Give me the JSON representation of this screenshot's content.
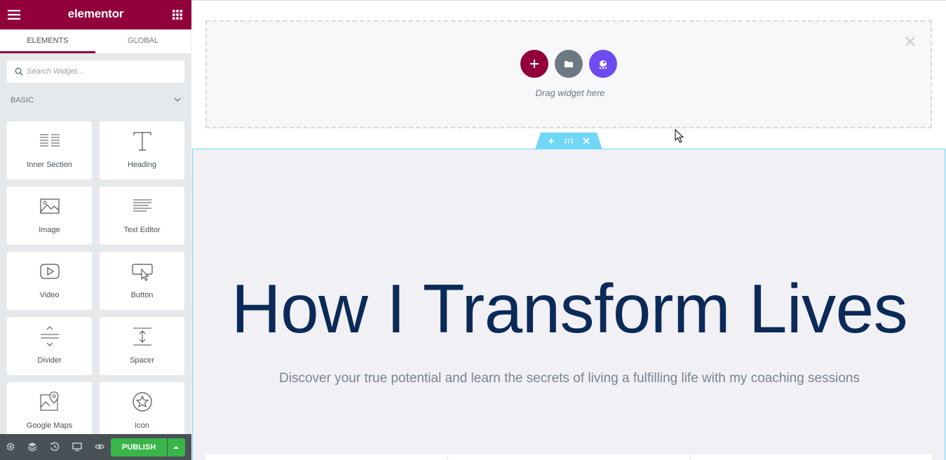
{
  "sidebar": {
    "logo": "elementor",
    "tabs": [
      {
        "label": "ELEMENTS",
        "active": true
      },
      {
        "label": "GLOBAL",
        "active": false
      }
    ],
    "search": {
      "placeholder": "Search Widget..."
    },
    "category": "BASIC",
    "widgets": [
      {
        "label": "Inner Section",
        "icon": "inner-section-icon"
      },
      {
        "label": "Heading",
        "icon": "heading-icon"
      },
      {
        "label": "Image",
        "icon": "image-icon"
      },
      {
        "label": "Text Editor",
        "icon": "text-editor-icon"
      },
      {
        "label": "Video",
        "icon": "video-icon"
      },
      {
        "label": "Button",
        "icon": "button-icon"
      },
      {
        "label": "Divider",
        "icon": "divider-icon"
      },
      {
        "label": "Spacer",
        "icon": "spacer-icon"
      },
      {
        "label": "Google Maps",
        "icon": "google-maps-icon"
      },
      {
        "label": "Icon",
        "icon": "star-icon"
      }
    ],
    "footer": {
      "publish_label": "PUBLISH",
      "icons": [
        "settings-icon",
        "layers-icon",
        "history-icon",
        "responsive-icon",
        "preview-icon"
      ]
    }
  },
  "canvas": {
    "dropzone_text": "Drag widget here",
    "headline": "How I Transform Lives",
    "subtext": "Discover your true potential and learn the secrets of living a fulfilling life with my coaching sessions"
  },
  "colors": {
    "brand": "#92003b",
    "publish": "#39b54a",
    "template_button": "#6d7882",
    "kit_button": "#6f4bf2",
    "section_handle": "#71d7f7",
    "headline": "#0b2a57"
  }
}
